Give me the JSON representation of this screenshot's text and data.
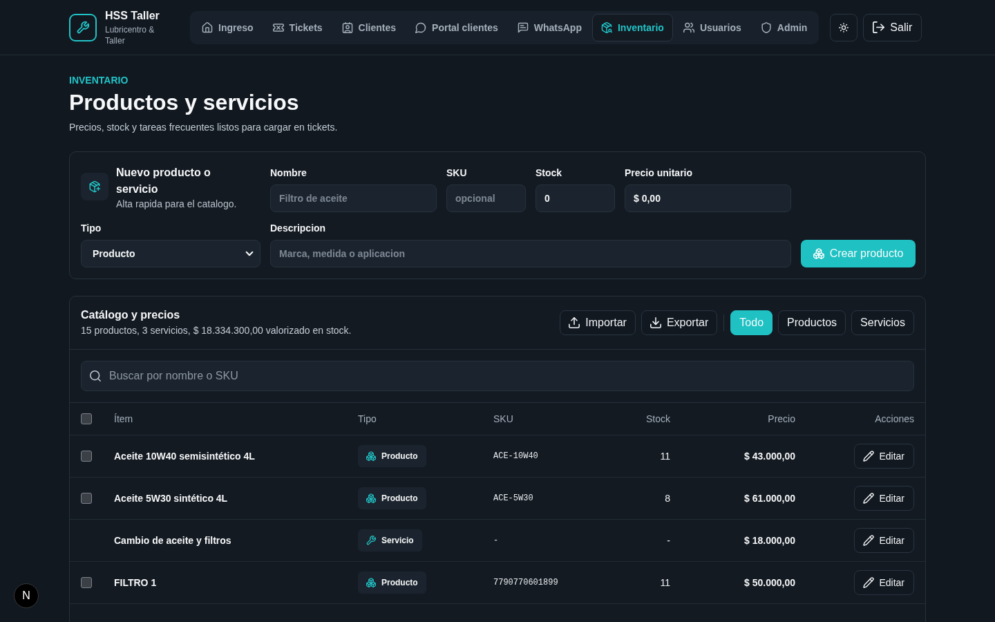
{
  "header": {
    "brand": {
      "name": "HSS Taller",
      "tagline": "Lubricentro & Taller"
    },
    "nav": [
      {
        "label": "Ingreso",
        "selected": false
      },
      {
        "label": "Tickets",
        "selected": false
      },
      {
        "label": "Clientes",
        "selected": false
      },
      {
        "label": "Portal clientes",
        "selected": false
      },
      {
        "label": "WhatsApp",
        "selected": false
      },
      {
        "label": "Inventario",
        "selected": true
      },
      {
        "label": "Usuarios",
        "selected": false
      },
      {
        "label": "Admin",
        "selected": false
      }
    ],
    "logout": "Salir"
  },
  "page": {
    "eyebrow": "INVENTARIO",
    "title": "Productos y servicios",
    "subtitle": "Precios, stock y tareas frecuentes listos para cargar en tickets."
  },
  "new_item": {
    "title": "Nuevo producto o servicio",
    "subtitle": "Alta rapida para el catalogo.",
    "fields": [
      {
        "label": "Nombre",
        "placeholder": "Filtro de aceite"
      },
      {
        "label": "SKU",
        "placeholder": "opcional"
      },
      {
        "label": "Stock",
        "value": "0"
      },
      {
        "label": "Precio unitario",
        "value": "$ 0,00"
      }
    ],
    "type_select": {
      "label": "Tipo",
      "value": "Producto"
    },
    "description": {
      "label": "Descripcion",
      "placeholder": "Marca, medida o aplicacion"
    },
    "submit": "Crear producto"
  },
  "catalog": {
    "title": "Catálogo y precios",
    "summary": "15 productos, 3 servicios, $ 18.334.300,00 valorizado en stock.",
    "actions": [
      "Importar",
      "Exportar"
    ],
    "filters": [
      {
        "label": "Todo",
        "selected": true
      },
      {
        "label": "Productos",
        "selected": false
      },
      {
        "label": "Servicios",
        "selected": false
      }
    ],
    "search": {
      "placeholder": "Buscar por nombre o SKU"
    },
    "table": {
      "select_all": {
        "checked": false
      },
      "columns": [
        "Ítem",
        "Tipo",
        "SKU",
        "Stock",
        "Precio",
        "Acciones"
      ],
      "rows": [
        {
          "checked": false,
          "name": "Aceite 10W40 semisintético 4L",
          "kind": "producto",
          "type": "Producto",
          "sku": "ACE-10W40",
          "stock": "11",
          "price": "$ 43.000,00",
          "action": "Editar"
        },
        {
          "checked": false,
          "name": "Aceite 5W30 sintético 4L",
          "kind": "producto",
          "type": "Producto",
          "sku": "ACE-5W30",
          "stock": "8",
          "price": "$ 61.000,00",
          "action": "Editar"
        },
        {
          "name": "Cambio de aceite y filtros",
          "kind": "servicio",
          "type": "Servicio",
          "sku": "-",
          "stock": "-",
          "price": "$ 18.000,00",
          "action": "Editar"
        },
        {
          "checked": false,
          "name": "FILTRO 1",
          "kind": "producto",
          "type": "Producto",
          "sku": "7790770601899",
          "stock": "11",
          "price": "$ 50.000,00",
          "action": "Editar"
        }
      ]
    }
  },
  "dev_indicator": {
    "label": "N"
  }
}
